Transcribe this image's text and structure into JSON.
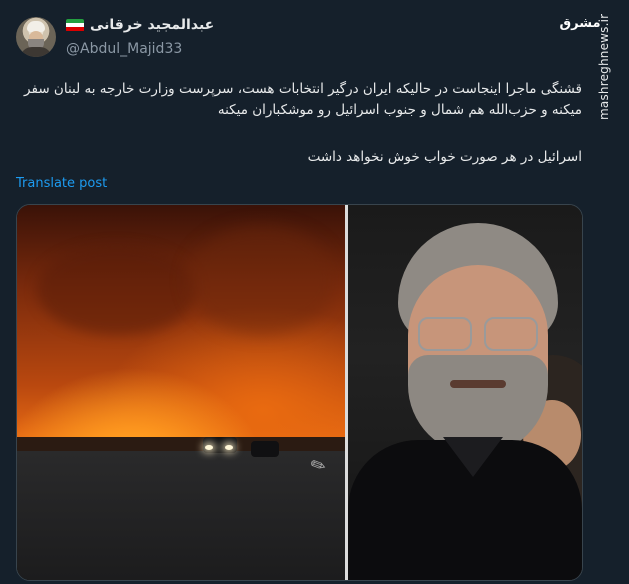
{
  "author": {
    "display_name": "عبدالمجید خرقانی",
    "handle": "@Abdul_Majid33",
    "flag": "iran-flag-icon"
  },
  "tweet": {
    "paragraph1": "قشنگی ماجرا اینجاست در حالیکه ایران درگیر انتخابات هست، سرپرست وزارت خارجه به لبنان سفر میکنه و حزب‌الله هم شمال و جنوب اسرائیل رو موشکباران میکنه",
    "paragraph2": "اسرائیل در هر صورت خواب خوش نخواهد داشت"
  },
  "actions": {
    "translate": "Translate post"
  },
  "branding": {
    "logo_text": "مشرق",
    "site": "mashreghnews.ir"
  },
  "colors": {
    "background": "#15202b",
    "link": "#1d9bf0",
    "muted": "#8b98a5"
  }
}
